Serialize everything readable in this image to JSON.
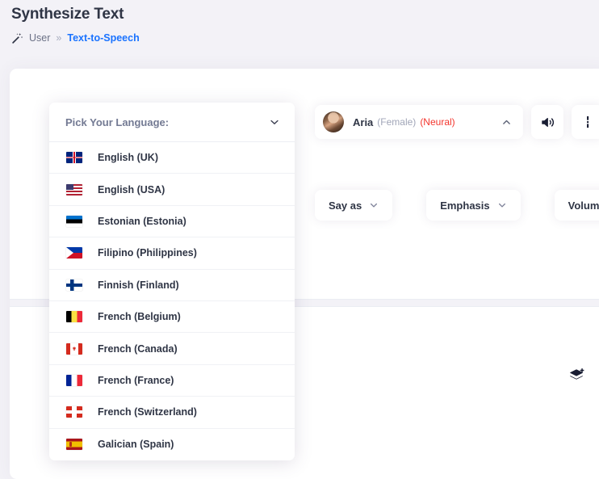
{
  "header": {
    "title": "Synthesize Text",
    "breadcrumb": {
      "icon": "magic-wand-icon",
      "root": "User",
      "separator": "»",
      "current": "Text-to-Speech"
    }
  },
  "toolbar": {
    "voice": {
      "name": "Aria",
      "gender": "(Female)",
      "type": "(Neural)",
      "caret_icon": "chevron-up-icon",
      "avatar_icon": "voice-avatar",
      "gender_color": "#a1a6b8",
      "type_color": "#f3352d"
    },
    "speaker_button": {
      "icon": "speaker-volume-icon"
    },
    "partial_button": {
      "icon": "partial-icon"
    },
    "tags": [
      {
        "label": "Say as",
        "icon": "chevron-down-icon"
      },
      {
        "label": "Emphasis",
        "icon": "chevron-down-icon"
      },
      {
        "label": "Volume",
        "icon": "chevron-down-icon"
      }
    ],
    "layers_button": {
      "icon": "add-layers-icon"
    }
  },
  "language_dropdown": {
    "header_label": "Pick Your Language:",
    "header_caret_icon": "chevron-down-icon",
    "items": [
      {
        "label": "English (UK)",
        "flag": "flag-uk"
      },
      {
        "label": "English (USA)",
        "flag": "flag-usa"
      },
      {
        "label": "Estonian (Estonia)",
        "flag": "flag-est"
      },
      {
        "label": "Filipino (Philippines)",
        "flag": "flag-phl"
      },
      {
        "label": "Finnish (Finland)",
        "flag": "flag-fin"
      },
      {
        "label": "French (Belgium)",
        "flag": "flag-bel"
      },
      {
        "label": "French (Canada)",
        "flag": "flag-can"
      },
      {
        "label": "French (France)",
        "flag": "flag-fra"
      },
      {
        "label": "French (Switzerland)",
        "flag": "flag-swi"
      },
      {
        "label": "Galician (Spain)",
        "flag": "flag-esp"
      }
    ]
  },
  "colors": {
    "page_background": "#f3f2f7",
    "card_background": "#ffffff",
    "accent_link": "#1a73ff",
    "title": "#2f3545",
    "muted": "#a1a6b8",
    "danger": "#f3352d"
  }
}
